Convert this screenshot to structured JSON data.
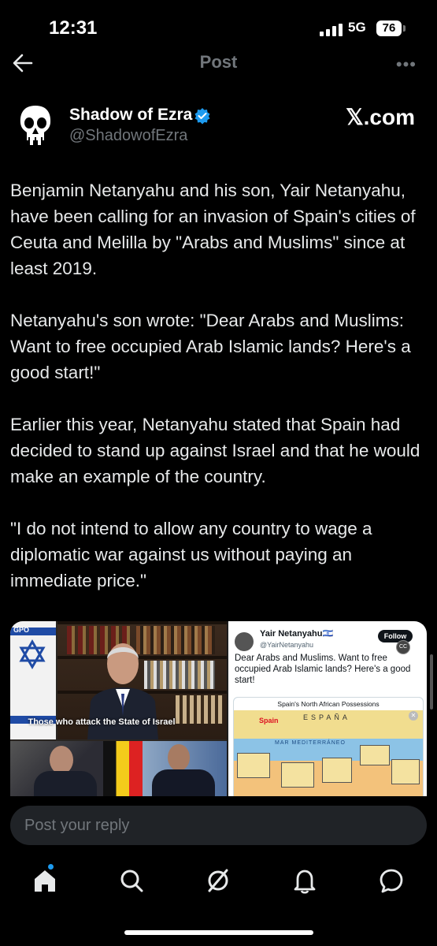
{
  "status_bar": {
    "time": "12:31",
    "network": "5G",
    "battery": "76"
  },
  "header": {
    "title": "Post"
  },
  "author": {
    "name": "Shadow of Ezra",
    "handle": "@ShadowofEzra",
    "source": "𝕏.com",
    "verified_color": "#1d9bf0"
  },
  "post": {
    "paragraphs": [
      "Benjamin Netanyahu and his son, Yair Netanyahu, have been calling for an invasion of Spain's cities of Ceuta and Melilla by \"Arabs and Muslims\" since at least 2019.",
      "Netanyahu's son wrote: \"Dear Arabs and Muslims: Want to free occupied Arab Islamic lands? Here's a good start!\"",
      "Earlier this year, Netanyahu stated that Spain had decided to stand up against Israel and that he would make an example of the country.",
      "\"I do not intend to allow any country to wage a diplomatic war against us without paying an immediate price.\""
    ]
  },
  "media": {
    "left": {
      "caption": "Those who attack the State of Israel",
      "logo": "GPO"
    },
    "right": {
      "name": "Yair Netanyahu🇮🇱",
      "handle": "@YairNetanyahu",
      "follow_label": "Follow",
      "cc_label": "CC",
      "text": "Dear Arabs and Muslims. Want to free occupied Arab Islamic lands? Here's a good start!",
      "map_title": "Spain's North African Possessions",
      "map_spain": "Spain",
      "map_espana": "ESPAÑA",
      "map_sea": "MAR MEDITERRÁNEO"
    }
  },
  "reply": {
    "placeholder": "Post your reply"
  },
  "tabs": [
    "home-icon",
    "search-icon",
    "grok-icon",
    "notifications-icon",
    "messages-icon"
  ]
}
